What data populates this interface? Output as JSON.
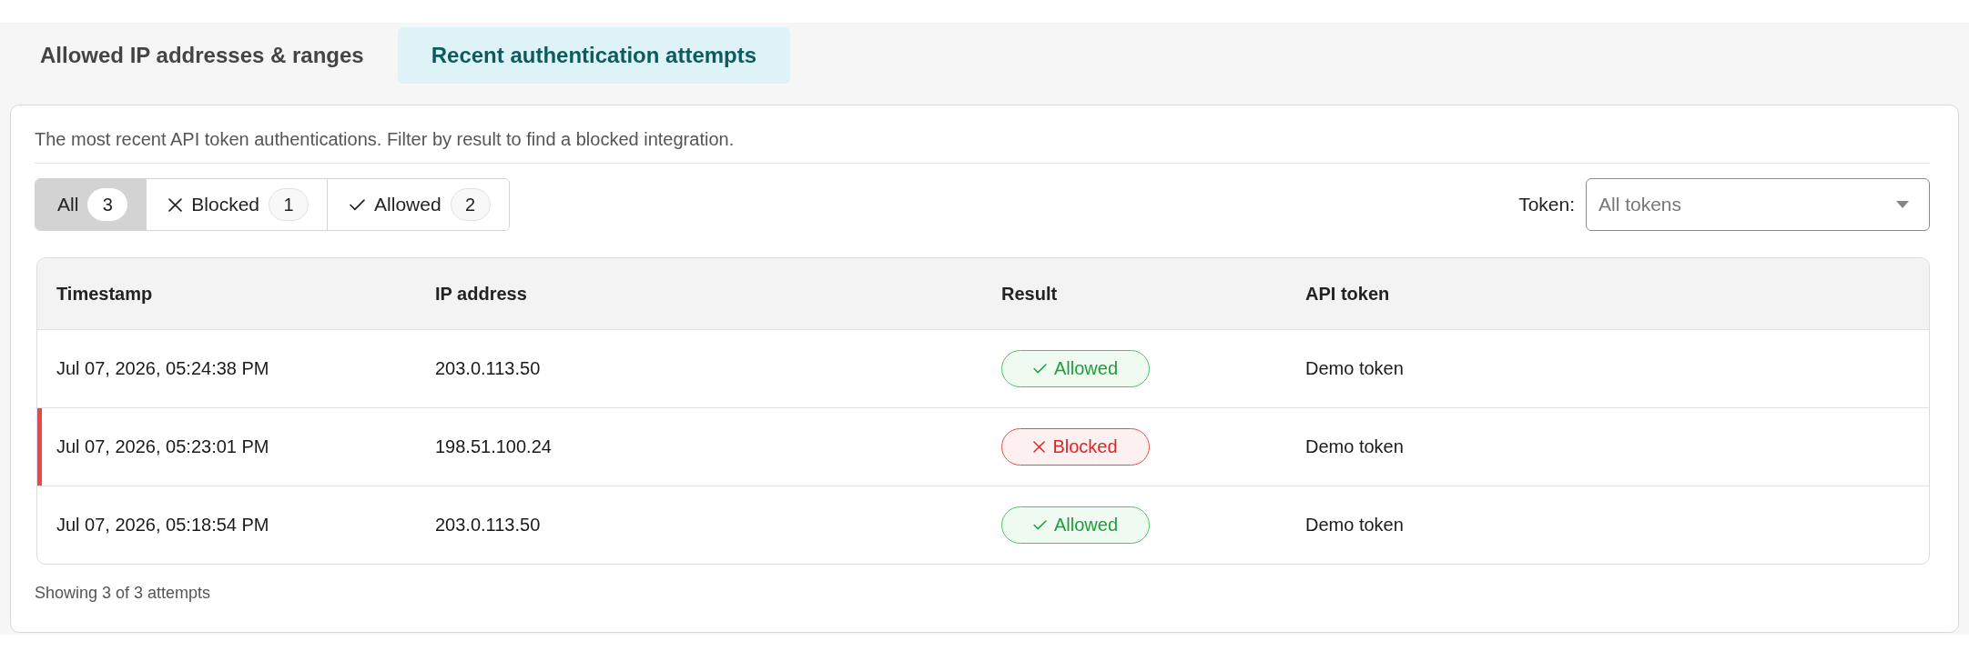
{
  "tabs": [
    {
      "label": "Allowed IP addresses & ranges",
      "selected": false
    },
    {
      "label": "Recent authentication attempts",
      "selected": true
    }
  ],
  "panel": {
    "description": "The most recent API token authentications. Filter by result to find a blocked integration.",
    "filters": [
      {
        "kind": "all",
        "label": "All",
        "count": "3",
        "selected": true
      },
      {
        "kind": "blocked",
        "label": "Blocked",
        "count": "1",
        "selected": false
      },
      {
        "kind": "allowed",
        "label": "Allowed",
        "count": "2",
        "selected": false
      }
    ],
    "token_filter": {
      "label": "Token:",
      "value": "All tokens"
    },
    "table": {
      "columns": [
        "Timestamp",
        "IP address",
        "Result",
        "API token"
      ],
      "rows": [
        {
          "timestamp": "Jul 07, 2026, 05:24:38 PM",
          "ip_address": "203.0.113.50",
          "result": {
            "kind": "allowed",
            "label": "Allowed"
          },
          "api_token": "Demo token",
          "highlighted": false
        },
        {
          "timestamp": "Jul 07, 2026, 05:23:01 PM",
          "ip_address": "198.51.100.24",
          "result": {
            "kind": "blocked",
            "label": "Blocked"
          },
          "api_token": "Demo token",
          "highlighted": true
        },
        {
          "timestamp": "Jul 07, 2026, 05:18:54 PM",
          "ip_address": "203.0.113.50",
          "result": {
            "kind": "allowed",
            "label": "Allowed"
          },
          "api_token": "Demo token",
          "highlighted": false
        }
      ]
    },
    "footer": "Showing 3 of 3 attempts"
  }
}
